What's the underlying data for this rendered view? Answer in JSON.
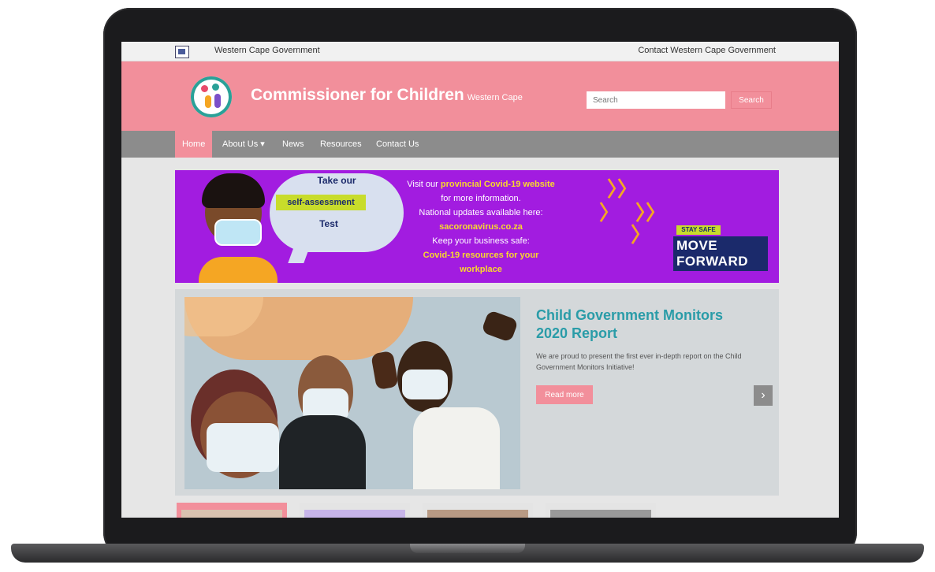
{
  "gov_bar": {
    "name": "Western Cape Government",
    "contact": "Contact Western Cape Government"
  },
  "header": {
    "title": "Commissioner for Children",
    "subtitle": "Western Cape",
    "search_placeholder": "Search",
    "search_button": "Search"
  },
  "nav": {
    "items": [
      "Home",
      "About Us ▾",
      "News",
      "Resources",
      "Contact Us"
    ],
    "active": "Home"
  },
  "covid_banner": {
    "take_our": "Take our",
    "self_assessment": "self-assessment",
    "test": "Test",
    "visit_prefix": "Visit our",
    "provincial_link": "provincial Covid-19 website",
    "more_info": "for more information.",
    "national_updates": "National updates available here:",
    "sacoronavirus_link": "sacoronavirus.co.za",
    "keep_safe": "Keep your business safe:",
    "workplace_link": "Covid-19 resources for your workplace",
    "stay_safe": "STAY SAFE",
    "move": "MOVE",
    "forward": "FORWARD",
    "colors": {
      "banner_bg": "#a21ce0",
      "link_yellow": "#f9d92c",
      "badge_green": "#c8dc2b",
      "navy": "#1b2a6b"
    }
  },
  "slider": {
    "title": "Child Government Monitors 2020 Report",
    "description": "We are proud to present the first ever in-depth report on the Child Government Monitors Initiative!",
    "read_more": "Read more",
    "next_icon": "chevron-right-icon"
  },
  "theme": {
    "header_pink": "#f28f9b",
    "nav_grey": "#8c8c8c",
    "title_teal": "#2a9ca8"
  }
}
